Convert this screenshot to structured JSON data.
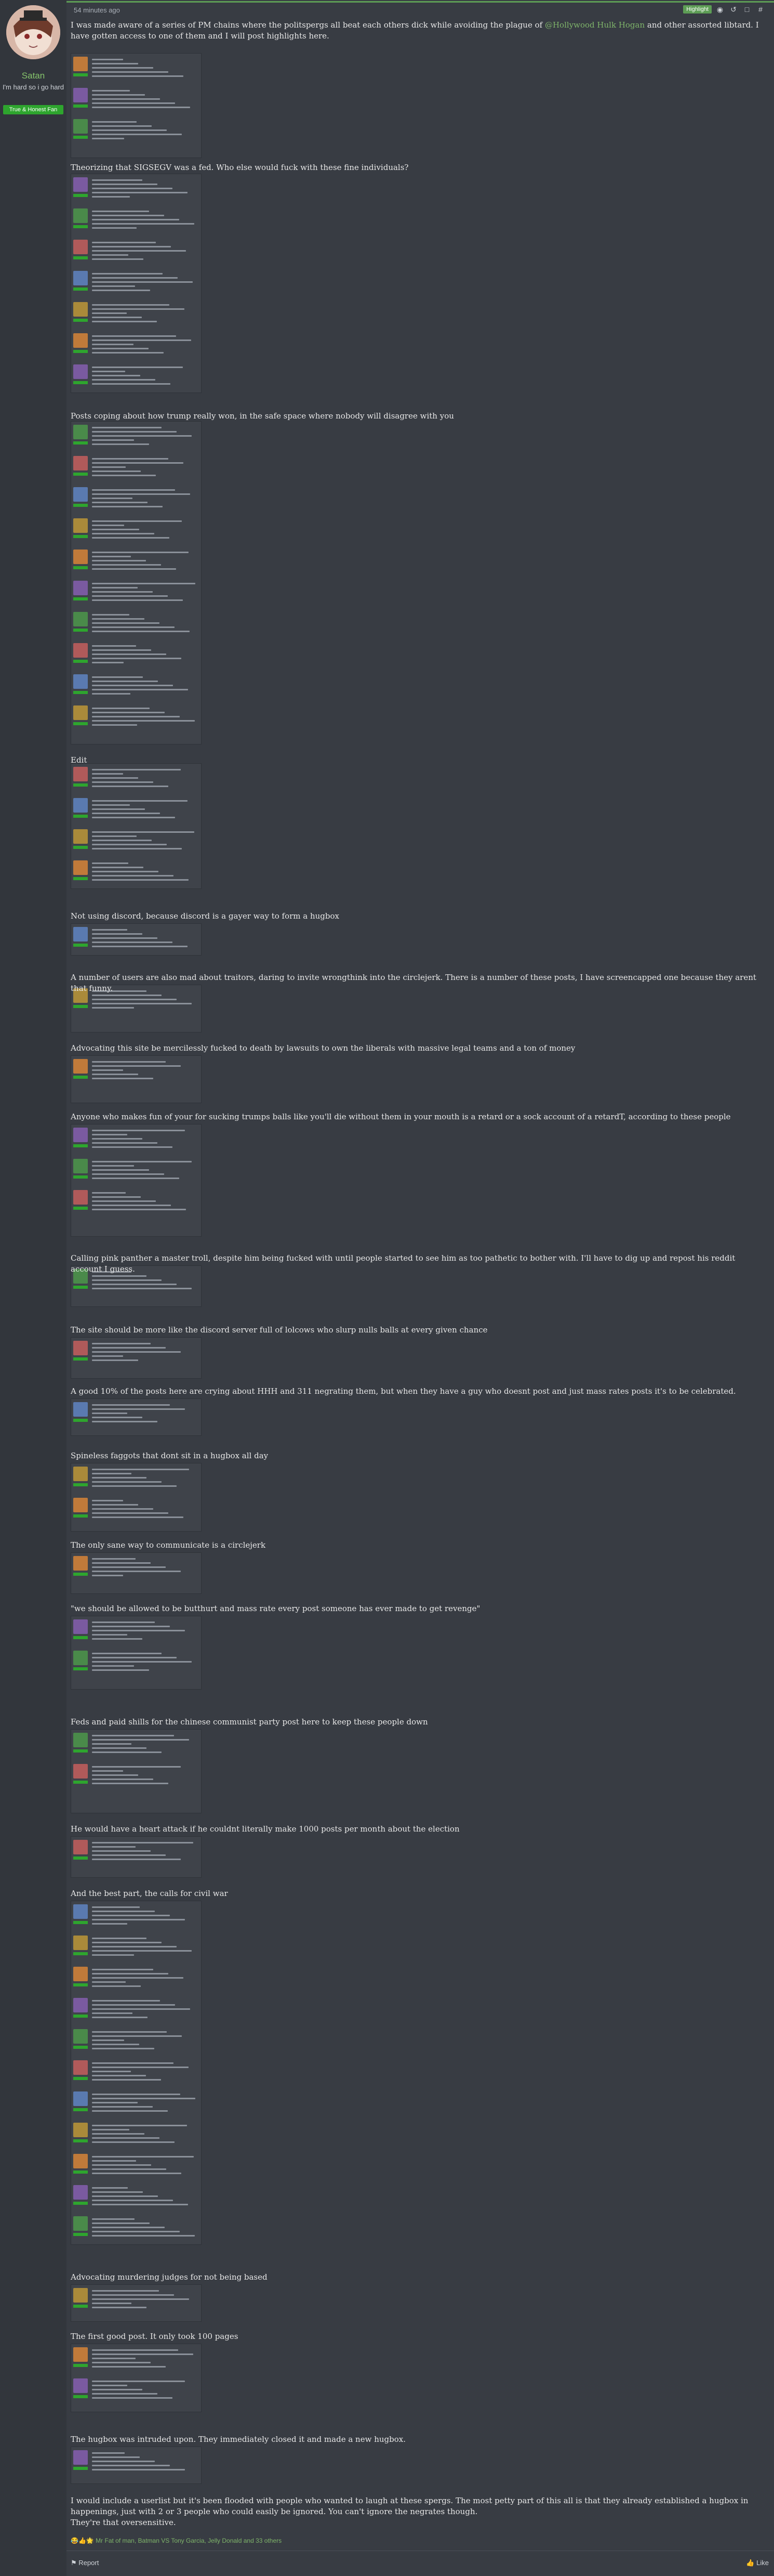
{
  "user": {
    "name": "Satan",
    "title": "I'm hard so i go hard",
    "banner": "True & Honest Fan"
  },
  "post": {
    "time": "54 minutes ago",
    "highlight": "Highlight",
    "intro": "I was made aware of a series of PM chains where the politspergs all beat each others dick while avoiding the plague of",
    "intro_mention": "@Hollywood Hulk Hogan",
    "intro_rest": "and other assorted libtard. I have gotten access to one of them and I will post highlights here.",
    "captions": [
      "Theorizing that SIGSEGV was a fed. Who else would fuck with these fine individuals?",
      "Posts coping about how trump really won, in the safe space where nobody will disagree with you",
      "Edit",
      "Not using discord, because discord is a gayer way to form a hugbox",
      "A number of users are also mad about traitors, daring to invite wrongthink into the circlejerk. There is a number of these posts, I have screencapped one because they arent that funny.",
      "Advocating this site be mercilessly fucked to death by lawsuits to own the liberals with massive legal teams and a ton of money",
      "Anyone who makes fun of your for sucking trumps balls like you'll die without them in your mouth is a retard or a sock account of a retardT, according to these people",
      "Calling pink panther a master troll, despite him being fucked with until people started to see him as too pathetic to bother with. I'll have to dig up and repost his reddit account I guess.",
      "The site should be more like the discord server full of lolcows who slurp nulls balls at every given chance",
      "A good 10% of the posts here are crying about HHH and 311 negrating them, but when they have a guy who doesnt post and just mass rates posts it's to be celebrated.",
      "Spineless faggots that dont sit in a hugbox all day",
      "The only sane way to communicate is a circlejerk",
      "\"we should be allowed to be butthurt and mass rate every post someone has ever made to get revenge\"",
      "Feds and paid shills for the chinese communist party post here to keep these people down",
      "He would have a heart attack if he couldnt literally make 1000 posts per month about the election",
      "And the best part, the calls for civil war",
      "Advocating murdering judges for not being based",
      "The first good post. It only took 100 pages",
      "The hugbox was intruded upon. They immediately closed it and made a new hugbox."
    ],
    "outro_1": "I would include a userlist but it's been flooded with people who wanted to laugh at these spergs. The most petty part of this all is that they already established a hugbox in happenings, just with 2 or 3 people who could easily be ignored. You can't ignore the negrates though.",
    "outro_2": "They're that oversensitive.",
    "reactions": "Mr Fat of man, Batman VS Tony Garcia, Jelly Donald and 33 others",
    "report": "Report",
    "like": "Like"
  }
}
